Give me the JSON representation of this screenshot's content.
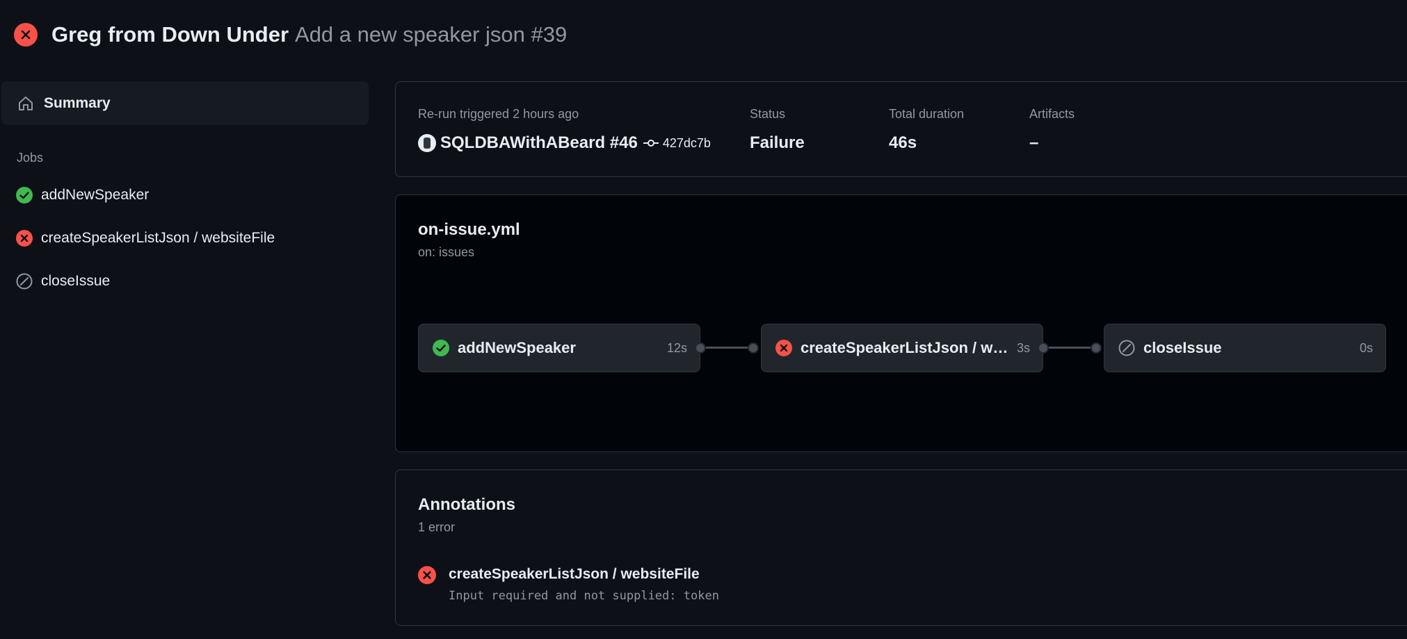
{
  "header": {
    "workflow_name": "Greg from Down Under",
    "run_title": "Add a new speaker json #39"
  },
  "sidebar": {
    "summary_label": "Summary",
    "jobs_heading": "Jobs",
    "jobs": [
      {
        "label": "addNewSpeaker",
        "status": "success"
      },
      {
        "label": "createSpeakerListJson / websiteFile",
        "status": "failure"
      },
      {
        "label": "closeIssue",
        "status": "skipped"
      }
    ]
  },
  "summary": {
    "trigger_label": "Re-run triggered 2 hours ago",
    "actor": "SQLDBAWithABeard #46",
    "commit": "427dc7b",
    "status_label": "Status",
    "status_value": "Failure",
    "duration_label": "Total duration",
    "duration_value": "46s",
    "artifacts_label": "Artifacts",
    "artifacts_value": "–"
  },
  "graph": {
    "file": "on-issue.yml",
    "trigger": "on: issues",
    "nodes": [
      {
        "label": "addNewSpeaker",
        "duration": "12s",
        "status": "success"
      },
      {
        "label": "createSpeakerListJson / websiteFile",
        "duration": "3s",
        "status": "failure"
      },
      {
        "label": "closeIssue",
        "duration": "0s",
        "status": "skipped"
      }
    ]
  },
  "annotations": {
    "title": "Annotations",
    "count": "1 error",
    "items": [
      {
        "job": "createSpeakerListJson / websiteFile",
        "message": "Input required and not supplied: token",
        "level": "error"
      }
    ]
  },
  "colors": {
    "success": "#3fb950",
    "failure": "#f85149",
    "muted": "#9198a1",
    "background": "#0d1117"
  }
}
